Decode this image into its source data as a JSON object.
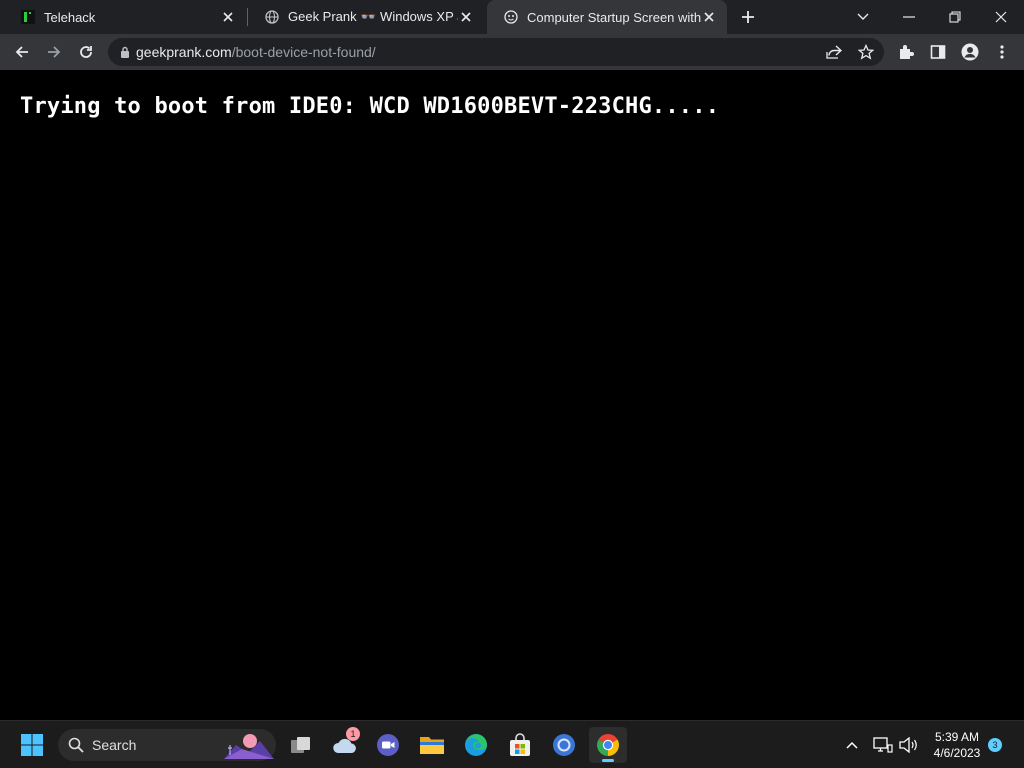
{
  "browser": {
    "tabs": [
      {
        "title": "Telehack",
        "favicon": "telehack-icon",
        "active": false
      },
      {
        "title": "Geek Prank 👓 Windows XP and",
        "favicon": "globe-icon",
        "active": false
      },
      {
        "title": "Computer Startup Screen with Bo",
        "favicon": "geekprank-icon",
        "active": true
      }
    ],
    "address": {
      "host": "geekprank.com",
      "path": "/boot-device-not-found/"
    }
  },
  "page": {
    "boot_message": "Trying to boot from IDE0: WCD WD1600BEVT-223CHG....."
  },
  "taskbar": {
    "search_label": "Search",
    "weather_badge": "1",
    "clock_time": "5:39 AM",
    "clock_date": "4/6/2023",
    "notification_count": "3"
  },
  "colors": {
    "tabstrip": "#202124",
    "toolbar": "#35363a",
    "page_background": "#000000",
    "boot_text": "#ffffff",
    "taskbar": "#1c1c1c",
    "accent": "#60cdff"
  }
}
